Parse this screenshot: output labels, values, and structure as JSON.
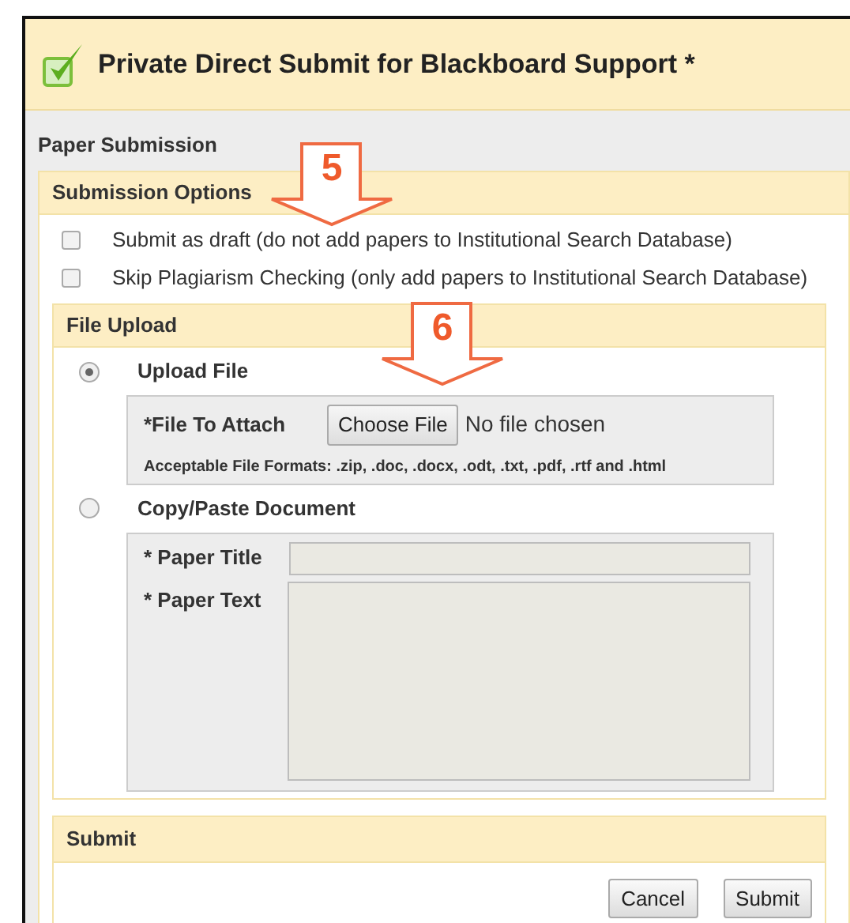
{
  "dialog": {
    "title": "Private Direct Submit for Blackboard Support *"
  },
  "section_title": "Paper Submission",
  "submission_options": {
    "heading": "Submission Options",
    "options": [
      {
        "label": "Submit as draft (do not add papers to Institutional Search Database)",
        "checked": false
      },
      {
        "label": "Skip Plagiarism Checking (only add papers to Institutional Search Database)",
        "checked": false
      }
    ]
  },
  "file_upload": {
    "heading": "File Upload",
    "methods": [
      {
        "kind": "upload",
        "label": "Upload File",
        "selected": true,
        "field_label": "*File To Attach",
        "button": "Choose File",
        "status": "No file chosen",
        "hint": "Acceptable File Formats: .zip, .doc, .docx, .odt, .txt, .pdf, .rtf and .html"
      },
      {
        "kind": "paste",
        "label": "Copy/Paste Document",
        "selected": false,
        "title_label": "* Paper Title",
        "text_label": "* Paper Text"
      }
    ]
  },
  "submit": {
    "heading": "Submit",
    "buttons": [
      "Cancel",
      "Submit"
    ]
  },
  "callouts": [
    {
      "number": "5"
    },
    {
      "number": "6"
    }
  ]
}
